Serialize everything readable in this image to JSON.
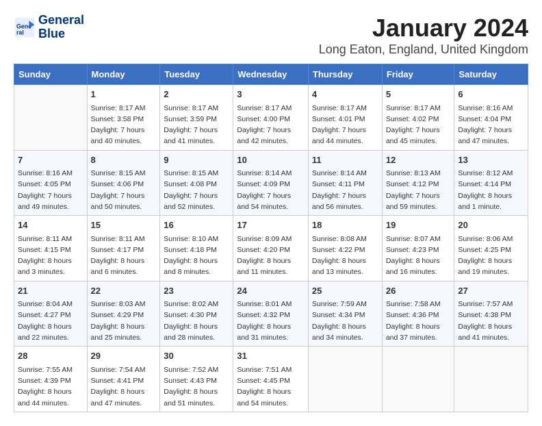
{
  "header": {
    "logo_line1": "General",
    "logo_line2": "Blue",
    "title": "January 2024",
    "location": "Long Eaton, England, United Kingdom"
  },
  "columns": [
    "Sunday",
    "Monday",
    "Tuesday",
    "Wednesday",
    "Thursday",
    "Friday",
    "Saturday"
  ],
  "weeks": [
    [
      {
        "day": "",
        "info": ""
      },
      {
        "day": "1",
        "info": "Sunrise: 8:17 AM\nSunset: 3:58 PM\nDaylight: 7 hours\nand 40 minutes."
      },
      {
        "day": "2",
        "info": "Sunrise: 8:17 AM\nSunset: 3:59 PM\nDaylight: 7 hours\nand 41 minutes."
      },
      {
        "day": "3",
        "info": "Sunrise: 8:17 AM\nSunset: 4:00 PM\nDaylight: 7 hours\nand 42 minutes."
      },
      {
        "day": "4",
        "info": "Sunrise: 8:17 AM\nSunset: 4:01 PM\nDaylight: 7 hours\nand 44 minutes."
      },
      {
        "day": "5",
        "info": "Sunrise: 8:17 AM\nSunset: 4:02 PM\nDaylight: 7 hours\nand 45 minutes."
      },
      {
        "day": "6",
        "info": "Sunrise: 8:16 AM\nSunset: 4:04 PM\nDaylight: 7 hours\nand 47 minutes."
      }
    ],
    [
      {
        "day": "7",
        "info": "Sunrise: 8:16 AM\nSunset: 4:05 PM\nDaylight: 7 hours\nand 49 minutes."
      },
      {
        "day": "8",
        "info": "Sunrise: 8:15 AM\nSunset: 4:06 PM\nDaylight: 7 hours\nand 50 minutes."
      },
      {
        "day": "9",
        "info": "Sunrise: 8:15 AM\nSunset: 4:08 PM\nDaylight: 7 hours\nand 52 minutes."
      },
      {
        "day": "10",
        "info": "Sunrise: 8:14 AM\nSunset: 4:09 PM\nDaylight: 7 hours\nand 54 minutes."
      },
      {
        "day": "11",
        "info": "Sunrise: 8:14 AM\nSunset: 4:11 PM\nDaylight: 7 hours\nand 56 minutes."
      },
      {
        "day": "12",
        "info": "Sunrise: 8:13 AM\nSunset: 4:12 PM\nDaylight: 7 hours\nand 59 minutes."
      },
      {
        "day": "13",
        "info": "Sunrise: 8:12 AM\nSunset: 4:14 PM\nDaylight: 8 hours\nand 1 minute."
      }
    ],
    [
      {
        "day": "14",
        "info": "Sunrise: 8:11 AM\nSunset: 4:15 PM\nDaylight: 8 hours\nand 3 minutes."
      },
      {
        "day": "15",
        "info": "Sunrise: 8:11 AM\nSunset: 4:17 PM\nDaylight: 8 hours\nand 6 minutes."
      },
      {
        "day": "16",
        "info": "Sunrise: 8:10 AM\nSunset: 4:18 PM\nDaylight: 8 hours\nand 8 minutes."
      },
      {
        "day": "17",
        "info": "Sunrise: 8:09 AM\nSunset: 4:20 PM\nDaylight: 8 hours\nand 11 minutes."
      },
      {
        "day": "18",
        "info": "Sunrise: 8:08 AM\nSunset: 4:22 PM\nDaylight: 8 hours\nand 13 minutes."
      },
      {
        "day": "19",
        "info": "Sunrise: 8:07 AM\nSunset: 4:23 PM\nDaylight: 8 hours\nand 16 minutes."
      },
      {
        "day": "20",
        "info": "Sunrise: 8:06 AM\nSunset: 4:25 PM\nDaylight: 8 hours\nand 19 minutes."
      }
    ],
    [
      {
        "day": "21",
        "info": "Sunrise: 8:04 AM\nSunset: 4:27 PM\nDaylight: 8 hours\nand 22 minutes."
      },
      {
        "day": "22",
        "info": "Sunrise: 8:03 AM\nSunset: 4:29 PM\nDaylight: 8 hours\nand 25 minutes."
      },
      {
        "day": "23",
        "info": "Sunrise: 8:02 AM\nSunset: 4:30 PM\nDaylight: 8 hours\nand 28 minutes."
      },
      {
        "day": "24",
        "info": "Sunrise: 8:01 AM\nSunset: 4:32 PM\nDaylight: 8 hours\nand 31 minutes."
      },
      {
        "day": "25",
        "info": "Sunrise: 7:59 AM\nSunset: 4:34 PM\nDaylight: 8 hours\nand 34 minutes."
      },
      {
        "day": "26",
        "info": "Sunrise: 7:58 AM\nSunset: 4:36 PM\nDaylight: 8 hours\nand 37 minutes."
      },
      {
        "day": "27",
        "info": "Sunrise: 7:57 AM\nSunset: 4:38 PM\nDaylight: 8 hours\nand 41 minutes."
      }
    ],
    [
      {
        "day": "28",
        "info": "Sunrise: 7:55 AM\nSunset: 4:39 PM\nDaylight: 8 hours\nand 44 minutes."
      },
      {
        "day": "29",
        "info": "Sunrise: 7:54 AM\nSunset: 4:41 PM\nDaylight: 8 hours\nand 47 minutes."
      },
      {
        "day": "30",
        "info": "Sunrise: 7:52 AM\nSunset: 4:43 PM\nDaylight: 8 hours\nand 51 minutes."
      },
      {
        "day": "31",
        "info": "Sunrise: 7:51 AM\nSunset: 4:45 PM\nDaylight: 8 hours\nand 54 minutes."
      },
      {
        "day": "",
        "info": ""
      },
      {
        "day": "",
        "info": ""
      },
      {
        "day": "",
        "info": ""
      }
    ]
  ]
}
